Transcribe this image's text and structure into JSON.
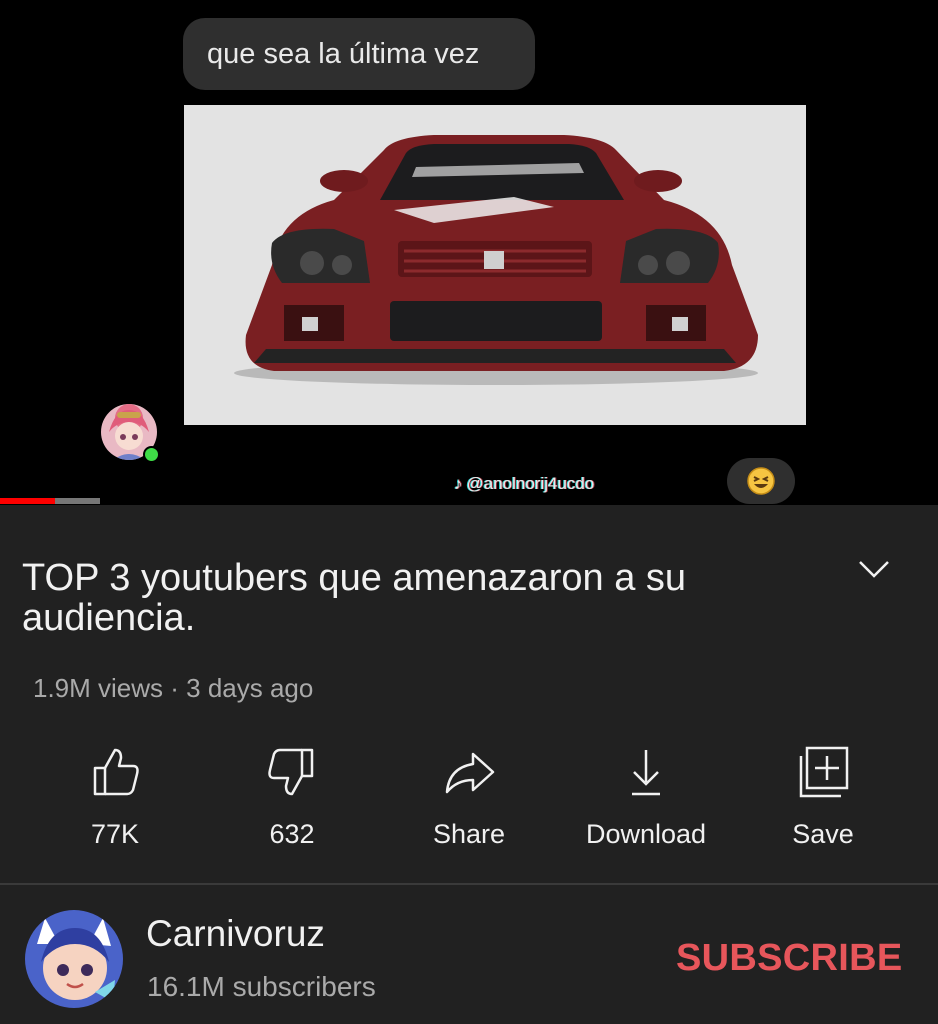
{
  "video": {
    "chat_message": "que sea la última vez",
    "watermark_handle": "@anolnorij4ucdo",
    "emoji": "😆",
    "progress": 0.55
  },
  "title": "TOP 3 youtubers que amenazaron a su audiencia.",
  "meta": "1.9M views · 3 days ago",
  "actions": [
    {
      "label": "77K",
      "icon": "thumbs-up-icon"
    },
    {
      "label": "632",
      "icon": "thumbs-down-icon"
    },
    {
      "label": "Share",
      "icon": "share-arrow-icon"
    },
    {
      "label": "Download",
      "icon": "download-icon"
    },
    {
      "label": "Save",
      "icon": "save-playlist-icon"
    }
  ],
  "channel": {
    "name": "Carnivoruz",
    "subscribers": "16.1M subscribers",
    "subscribe_label": "SUBSCRIBE"
  },
  "colors": {
    "background": "#212121",
    "subscribe": "#e7565b",
    "progress": "#ff0000",
    "secondary_text": "#aaaaaa"
  }
}
